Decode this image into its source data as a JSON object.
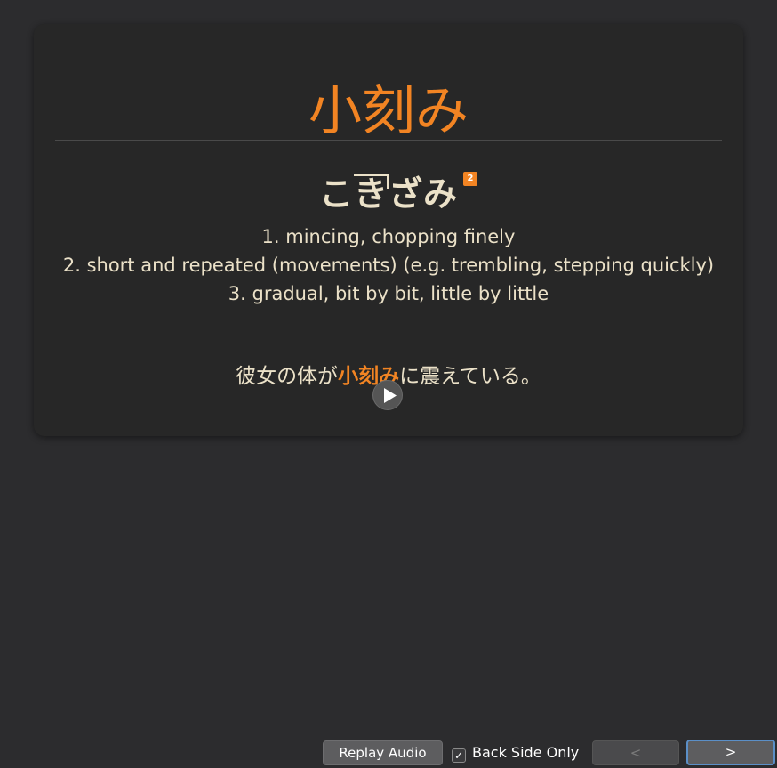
{
  "card": {
    "headword": "小刻み",
    "reading": {
      "before": "こ",
      "accented": "き",
      "after": "ざみ",
      "pitch_number": "2"
    },
    "definitions": [
      "1. mincing, chopping finely",
      "2. short and repeated (movements) (e.g. trembling, stepping quickly)",
      "3. gradual, bit by bit, little by little"
    ],
    "sentence": {
      "before": "彼女の体が",
      "highlight": "小刻み",
      "after": "に震えている。"
    },
    "play_icon": "play-icon"
  },
  "toolbar": {
    "replay_audio": "Replay Audio",
    "back_side_only": "Back Side Only",
    "back_side_only_checked": true,
    "prev": "<",
    "next": ">"
  },
  "colors": {
    "accent": "#f28423",
    "text": "#ebe1c8",
    "background": "#2c2c2e",
    "card": "#272727",
    "focus_ring": "#5b8fc7"
  }
}
